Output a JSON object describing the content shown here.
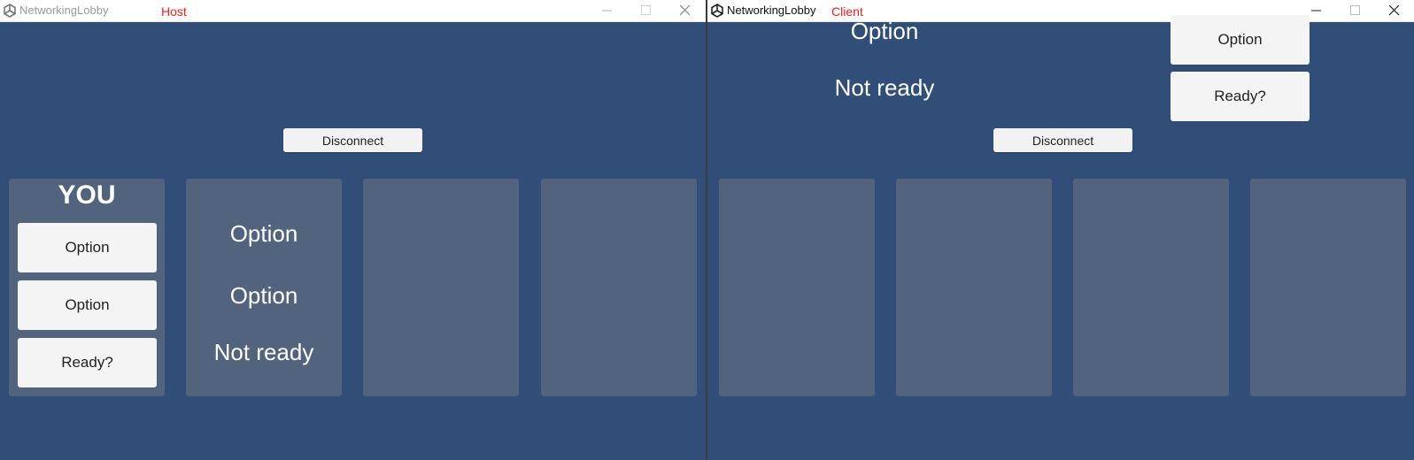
{
  "host": {
    "window_title": "NetworkingLobby",
    "tag": "Host",
    "disconnect_label": "Disconnect",
    "you_label": "YOU",
    "you_panel": {
      "option1": "Option",
      "option2": "Option",
      "ready_button": "Ready?"
    },
    "other_player": {
      "option1": "Option",
      "option2": "Option",
      "status": "Not ready"
    }
  },
  "client": {
    "window_title": "NetworkingLobby",
    "tag": "Client",
    "disconnect_label": "Disconnect",
    "top_option_text": "Option",
    "status_text": "Not ready",
    "option_button": "Option",
    "ready_button": "Ready?"
  },
  "icons": {
    "app": "unity-logo-icon",
    "minimize": "minimize-icon",
    "maximize": "maximize-icon",
    "close": "close-icon"
  },
  "colors": {
    "background": "#304e78",
    "panel": "#52637d",
    "button": "#f2f2f2",
    "tag": "#ff1a1a"
  }
}
